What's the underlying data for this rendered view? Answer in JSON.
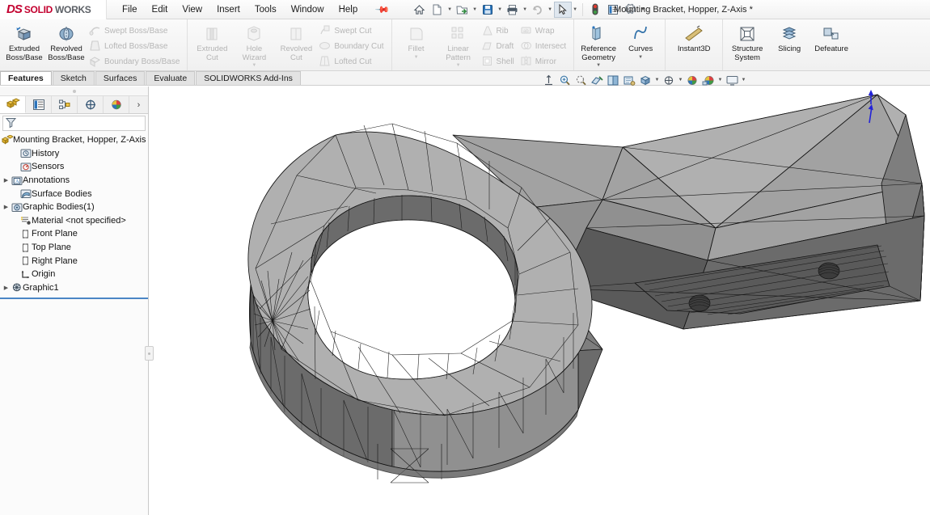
{
  "app": {
    "brand_ds": "DS",
    "brand_solid": "SOLID",
    "brand_works": "WORKS",
    "document_title": "Mounting Bracket, Hopper, Z-Axis *",
    "accent_red": "#c3002f",
    "accent_blue": "#1a6fc4",
    "model_fill": "#9c9c9c",
    "model_edge": "#1a1a1a"
  },
  "menu": {
    "items": [
      {
        "label": "File",
        "name": "menu-file"
      },
      {
        "label": "Edit",
        "name": "menu-edit"
      },
      {
        "label": "View",
        "name": "menu-view"
      },
      {
        "label": "Insert",
        "name": "menu-insert"
      },
      {
        "label": "Tools",
        "name": "menu-tools"
      },
      {
        "label": "Window",
        "name": "menu-window"
      },
      {
        "label": "Help",
        "name": "menu-help"
      }
    ],
    "pin_icon": "pushpin-icon"
  },
  "quick_access": {
    "items": [
      {
        "name": "home-icon",
        "label": "Home"
      },
      {
        "name": "new-document-icon",
        "label": "New"
      },
      {
        "name": "open-document-icon",
        "label": "Open"
      },
      {
        "name": "save-icon",
        "label": "Save"
      },
      {
        "name": "print-icon",
        "label": "Print"
      },
      {
        "name": "undo-icon",
        "label": "Undo"
      },
      {
        "name": "select-pointer-icon",
        "label": "Select"
      },
      {
        "name": "rebuild-icon",
        "label": "Rebuild"
      },
      {
        "name": "options-list-icon",
        "label": "File Properties"
      },
      {
        "name": "gear-icon",
        "label": "Options"
      }
    ]
  },
  "ribbon": {
    "groups": [
      {
        "name": "boss-base-group",
        "big": [
          {
            "label_l1": "Extruded",
            "label_l2": "Boss/Base",
            "icon": "extruded-boss-icon",
            "disabled": false,
            "dropdown": false
          },
          {
            "label_l1": "Revolved",
            "label_l2": "Boss/Base",
            "icon": "revolved-boss-icon",
            "disabled": false,
            "dropdown": false
          }
        ],
        "small": [
          {
            "label": "Swept Boss/Base",
            "icon": "swept-boss-icon",
            "disabled": true
          },
          {
            "label": "Lofted Boss/Base",
            "icon": "lofted-boss-icon",
            "disabled": true
          },
          {
            "label": "Boundary Boss/Base",
            "icon": "boundary-boss-icon",
            "disabled": true
          }
        ]
      },
      {
        "name": "cut-group",
        "big": [
          {
            "label_l1": "Extruded",
            "label_l2": "Cut",
            "icon": "extruded-cut-icon",
            "disabled": true,
            "dropdown": false
          },
          {
            "label_l1": "Hole",
            "label_l2": "Wizard",
            "icon": "hole-wizard-icon",
            "disabled": true,
            "dropdown": true
          },
          {
            "label_l1": "Revolved",
            "label_l2": "Cut",
            "icon": "revolved-cut-icon",
            "disabled": true,
            "dropdown": false
          }
        ],
        "small": [
          {
            "label": "Swept Cut",
            "icon": "swept-cut-icon",
            "disabled": true
          },
          {
            "label": "Boundary Cut",
            "icon": "boundary-cut-icon",
            "disabled": true
          },
          {
            "label": "Lofted Cut",
            "icon": "lofted-cut-icon",
            "disabled": true
          }
        ]
      },
      {
        "name": "feature-group",
        "big": [
          {
            "label_l1": "Fillet",
            "label_l2": "",
            "icon": "fillet-icon",
            "disabled": true,
            "dropdown": true
          },
          {
            "label_l1": "Linear",
            "label_l2": "Pattern",
            "icon": "linear-pattern-icon",
            "disabled": true,
            "dropdown": true
          }
        ],
        "small": [
          {
            "label": "Rib",
            "icon": "rib-icon",
            "disabled": true
          },
          {
            "label": "Draft",
            "icon": "draft-icon",
            "disabled": true
          },
          {
            "label": "Shell",
            "icon": "shell-icon",
            "disabled": true
          }
        ],
        "small2": [
          {
            "label": "Wrap",
            "icon": "wrap-icon",
            "disabled": true
          },
          {
            "label": "Intersect",
            "icon": "intersect-icon",
            "disabled": true
          },
          {
            "label": "Mirror",
            "icon": "mirror-icon",
            "disabled": true
          }
        ]
      },
      {
        "name": "reference-group",
        "big": [
          {
            "label_l1": "Reference",
            "label_l2": "Geometry",
            "icon": "reference-geometry-icon",
            "disabled": false,
            "dropdown": true
          },
          {
            "label_l1": "Curves",
            "label_l2": "",
            "icon": "curves-icon",
            "disabled": false,
            "dropdown": true
          }
        ],
        "small": []
      },
      {
        "name": "instant3d-group",
        "big": [
          {
            "label_l1": "Instant3D",
            "label_l2": "",
            "icon": "instant3d-icon",
            "disabled": false,
            "dropdown": false
          }
        ],
        "small": []
      },
      {
        "name": "tools-group",
        "big": [
          {
            "label_l1": "Structure",
            "label_l2": "System",
            "icon": "structure-system-icon",
            "disabled": false,
            "dropdown": false
          },
          {
            "label_l1": "Slicing",
            "label_l2": "",
            "icon": "slicing-icon",
            "disabled": false,
            "dropdown": false
          },
          {
            "label_l1": "Defeature",
            "label_l2": "",
            "icon": "defeature-icon",
            "disabled": false,
            "dropdown": false
          }
        ],
        "small": []
      }
    ]
  },
  "tabs": [
    {
      "label": "Features",
      "active": true,
      "name": "tab-features"
    },
    {
      "label": "Sketch",
      "active": false,
      "name": "tab-sketch"
    },
    {
      "label": "Surfaces",
      "active": false,
      "name": "tab-surfaces"
    },
    {
      "label": "Evaluate",
      "active": false,
      "name": "tab-evaluate"
    },
    {
      "label": "SOLIDWORKS Add-Ins",
      "active": false,
      "name": "tab-solidworks-addins"
    }
  ],
  "view_toolbar": {
    "items": [
      {
        "name": "zoom-to-fit-icon",
        "label": "Zoom to Fit"
      },
      {
        "name": "zoom-area-icon",
        "label": "Zoom to Area"
      },
      {
        "name": "previous-view-icon",
        "label": "Previous View"
      },
      {
        "name": "section-view-icon",
        "label": "Section View"
      },
      {
        "name": "view-orientation-icon",
        "label": "View Orientation"
      },
      {
        "name": "display-style-icon",
        "label": "Display Style"
      },
      {
        "name": "hide-show-items-icon",
        "label": "Hide/Show Items"
      },
      {
        "name": "edit-appearance-icon",
        "label": "Edit Appearance"
      },
      {
        "name": "apply-scene-icon",
        "label": "Apply Scene"
      },
      {
        "name": "view-settings-icon",
        "label": "View Settings"
      }
    ]
  },
  "left_panel": {
    "tabs": [
      {
        "name": "feature-manager-tab",
        "label": "FeatureManager Design Tree",
        "active": true
      },
      {
        "name": "property-manager-tab",
        "label": "PropertyManager",
        "active": false
      },
      {
        "name": "configuration-manager-tab",
        "label": "ConfigurationManager",
        "active": false
      },
      {
        "name": "dimxpert-manager-tab",
        "label": "DimXpertManager",
        "active": false
      },
      {
        "name": "display-manager-tab",
        "label": "DisplayManager",
        "active": false
      }
    ],
    "more_icon": "chevron-right-icon",
    "filter_icon": "filter-icon",
    "filter_placeholder": "",
    "tree": [
      {
        "label": "Mounting Bracket, Hopper, Z-Axis  (Defa",
        "icon": "part-icon",
        "indent": 0,
        "expandable": false,
        "name": "tree-item-part-root"
      },
      {
        "label": "History",
        "icon": "history-icon",
        "indent": 1,
        "expandable": false,
        "name": "tree-item-history"
      },
      {
        "label": "Sensors",
        "icon": "sensors-icon",
        "indent": 1,
        "expandable": false,
        "name": "tree-item-sensors"
      },
      {
        "label": "Annotations",
        "icon": "annotations-icon",
        "indent": 1,
        "expandable": true,
        "name": "tree-item-annotations"
      },
      {
        "label": "Surface Bodies",
        "icon": "surface-bodies-icon",
        "indent": 1,
        "expandable": false,
        "name": "tree-item-surface-bodies"
      },
      {
        "label": "Graphic Bodies(1)",
        "icon": "graphic-bodies-icon",
        "indent": 1,
        "expandable": true,
        "name": "tree-item-graphic-bodies"
      },
      {
        "label": "Material <not specified>",
        "icon": "material-icon",
        "indent": 1,
        "expandable": false,
        "name": "tree-item-material"
      },
      {
        "label": "Front Plane",
        "icon": "plane-icon",
        "indent": 1,
        "expandable": false,
        "name": "tree-item-front-plane"
      },
      {
        "label": "Top Plane",
        "icon": "plane-icon",
        "indent": 1,
        "expandable": false,
        "name": "tree-item-top-plane"
      },
      {
        "label": "Right Plane",
        "icon": "plane-icon",
        "indent": 1,
        "expandable": false,
        "name": "tree-item-right-plane"
      },
      {
        "label": "Origin",
        "icon": "origin-icon",
        "indent": 1,
        "expandable": false,
        "name": "tree-item-origin"
      },
      {
        "label": "Graphic1",
        "icon": "graphic-mesh-icon",
        "indent": 1,
        "expandable": true,
        "name": "tree-item-graphic1"
      }
    ]
  },
  "graphics": {
    "model_name": "mounting-bracket-mesh",
    "triad_icon": "origin-triad-icon"
  }
}
